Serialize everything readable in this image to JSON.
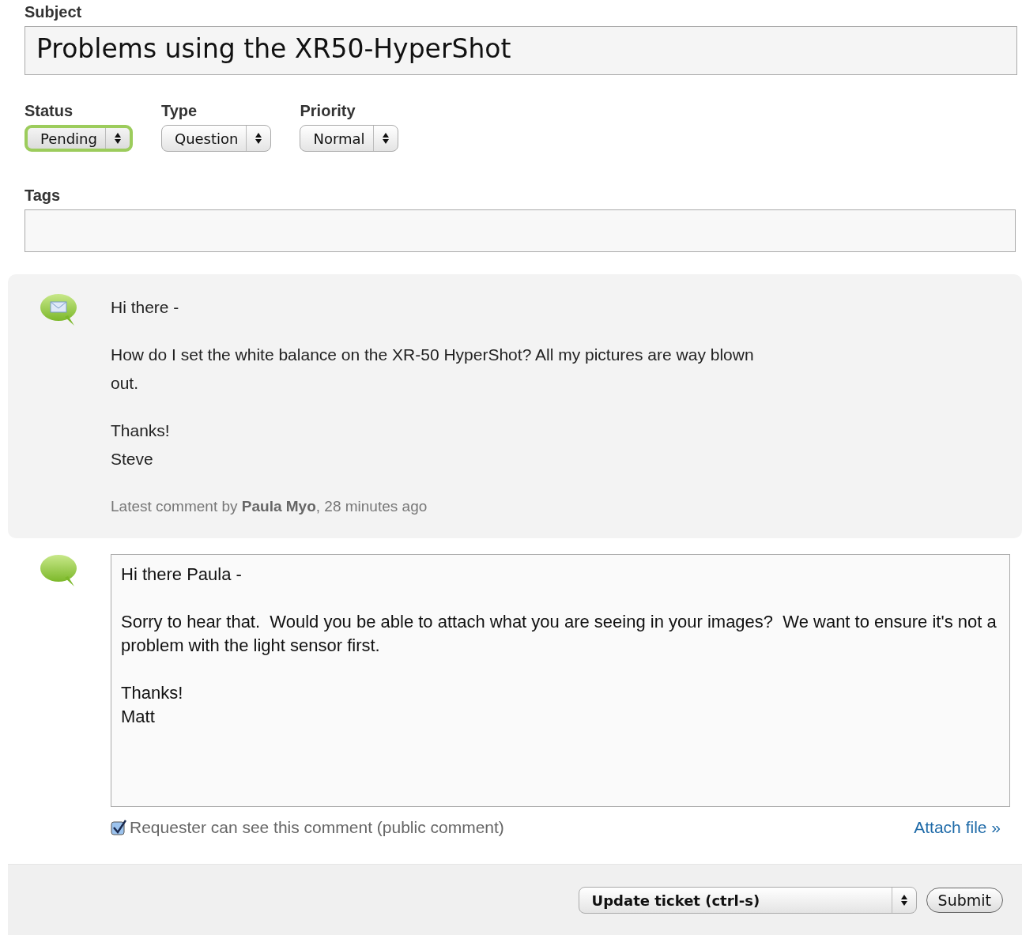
{
  "subject": {
    "label": "Subject",
    "value": "Problems using the XR50-HyperShot"
  },
  "selects": [
    {
      "label": "Status",
      "value": "Pending",
      "focused": true
    },
    {
      "label": "Type",
      "value": "Question",
      "focused": false
    },
    {
      "label": "Priority",
      "value": "Normal",
      "focused": false
    }
  ],
  "tags": {
    "label": "Tags"
  },
  "comment": {
    "paragraphs": [
      "Hi there -",
      "How do I set the white balance on the XR-50 HyperShot? All my pictures are way blown out.",
      "Thanks!\nSteve"
    ],
    "meta": "Latest comment by **Paula Myo**, 28 minutes ago"
  },
  "reply": {
    "value": "Hi there Paula -\n\nSorry to hear that.  Would you be able to attach what you are seeing in your images?  We want to ensure it's not a problem with the light sensor first.\n\nThanks!\nMatt",
    "public": {
      "label": "Requester can see this comment (public comment)",
      "checked": true
    },
    "attach": "Attach file »"
  },
  "footer": {
    "action": "Update ticket (ctrl-s)",
    "submit": "Submit"
  }
}
